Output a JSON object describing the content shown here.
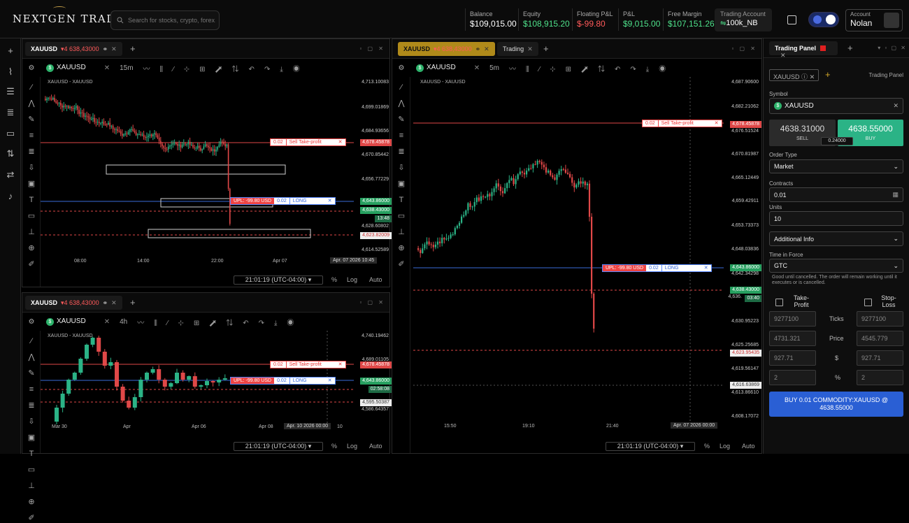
{
  "header": {
    "logo": "NEXTGEN TRADER",
    "search_placeholder": "Search for stocks, crypto, forex...",
    "stats": [
      {
        "label": "Balance",
        "value": "$109,015.00",
        "color": "#ffffff"
      },
      {
        "label": "Equity",
        "value": "$108,915.20",
        "color": "#4ee08a"
      },
      {
        "label": "Floating P&L",
        "value": "$-99.80",
        "color": "#ff5a5a"
      },
      {
        "label": "P&L",
        "value": "$9,015.00",
        "color": "#4ee08a"
      },
      {
        "label": "Free Margin",
        "value": "$107,151.26",
        "color": "#4ee08a"
      }
    ],
    "trading_account_label": "Trading Account",
    "trading_account_value": "100k_NB",
    "account_label": "Account",
    "account_name": "Nolan"
  },
  "chart_tl": {
    "tab_symbol": "XAUUSD",
    "tab_price": "▾4 638,43000",
    "symbol": "XAUUSD",
    "timeframe": "15m",
    "title": "XAUUSD - XAUUSD",
    "prices": [
      "4,713.10083",
      "4,699.01869",
      "4,684.93656",
      "4,670.85442",
      "4,656.77229",
      "4,628.60802",
      "4,614.52589"
    ],
    "price_tp": "4,678.45878",
    "price_entry": "4,643.86000",
    "price_cur": "4,638.43000",
    "countdown": "13:48",
    "price_sl": "4,623.82009",
    "times": [
      "08:00",
      "14:00",
      "22:00",
      "Apr 07"
    ],
    "crosshair_time": "Apr. 07 2026 10:45",
    "tz": "21:01:19 (UTC-04:00)",
    "tp_qty": "0.02",
    "tp_label": "Sell  Take-profit",
    "pos_upl": "UPL: -99.80 USD",
    "pos_qty": "0.02",
    "pos_label": "LONG"
  },
  "chart_bl": {
    "tab_symbol": "XAUUSD",
    "tab_price": "▾4 638,43000",
    "symbol": "XAUUSD",
    "timeframe": "4h",
    "title": "XAUUSD - XAUUSD",
    "prices": [
      "4,740.19462",
      "4,689.01105"
    ],
    "price_tp": "4,678.45878",
    "price_entry": "4,643.86000",
    "countdown": "02:58:08",
    "price_sl": "4,595.50387",
    "price_low": "4,586.64357",
    "times": [
      "Mar 30",
      "Apr",
      "Apr 06",
      "Apr 08",
      "10"
    ],
    "crosshair_time": "Apr. 10 2026 00:00",
    "tz": "21:01:19 (UTC-04:00)",
    "tp_qty": "0.02",
    "tp_label": "Sell  Take-profit",
    "pos_upl": "UPL: -99.80 USD",
    "pos_qty": "0.02",
    "pos_label": "LONG"
  },
  "chart_r": {
    "tab_symbol": "XAUUSD",
    "tab_price": "▾4 638,43000",
    "tab2": "Trading",
    "symbol": "XAUUSD",
    "timeframe": "5m",
    "title": "XAUUSD - XAUUSD",
    "prices": [
      "4,687.90600",
      "4,682.21062",
      "4,670.81987",
      "4,665.12449",
      "4,659.42911",
      "4,653.73373",
      "4,648.03836",
      "4,642.34298",
      "4,630.95223",
      "4,625.25685",
      "4,619.56147",
      "4,613.86610",
      "4,608.17072"
    ],
    "price_tp": "4,678.45878",
    "price_top2": "4,676.51524",
    "price_entry": "4,643.86000",
    "price_cur": "4,638.43000",
    "price_cur_cut": "4,636.",
    "countdown": "03:40",
    "price_sl": "4,623.95435",
    "price_low": "4,616.63869",
    "times": [
      "15:50",
      "19:10",
      "21:40"
    ],
    "crosshair_time": "Apr. 07 2026 00:00",
    "tz": "21:01:19 (UTC-04:00)",
    "tp_qty": "0.02",
    "tp_label": "Sell  Take-profit",
    "pos_upl": "UPL: -99.80 USD",
    "pos_qty": "0.02",
    "pos_label": "LONG"
  },
  "bottom": {
    "pct": "%",
    "log": "Log",
    "auto": "Auto"
  },
  "panel": {
    "tab": "Trading Panel",
    "symbol_chip": "XAUUSD",
    "title_right": "Trading Panel",
    "symbol_label": "Symbol",
    "symbol_value": "XAUUSD",
    "sell_price": "4638.31000",
    "sell_label": "SELL",
    "buy_price": "4638.55000",
    "buy_label": "BUY",
    "spread": "0.24000",
    "order_type_label": "Order Type",
    "order_type": "Market",
    "contracts_label": "Contracts",
    "contracts": "0.01",
    "units_label": "Units",
    "units": "10",
    "additional": "Additional Info",
    "tif_label": "Time in Force",
    "tif": "GTC",
    "tif_note": "Good until cancelled. The order will remain working until it executes or is cancelled.",
    "tp_label": "Take-Profit",
    "sl_label": "Stop-Loss",
    "rows": [
      {
        "label": "Ticks",
        "tp": "9277100",
        "sl": "9277100"
      },
      {
        "label": "Price",
        "tp": "4731.321",
        "sl": "4545.779"
      },
      {
        "label": "$",
        "tp": "927.71",
        "sl": "927.71"
      },
      {
        "label": "%",
        "tp": "2",
        "sl": "2"
      }
    ],
    "buy_button": "BUY 0.01 COMMODITY:XAUUSD @ 4638.55000"
  }
}
